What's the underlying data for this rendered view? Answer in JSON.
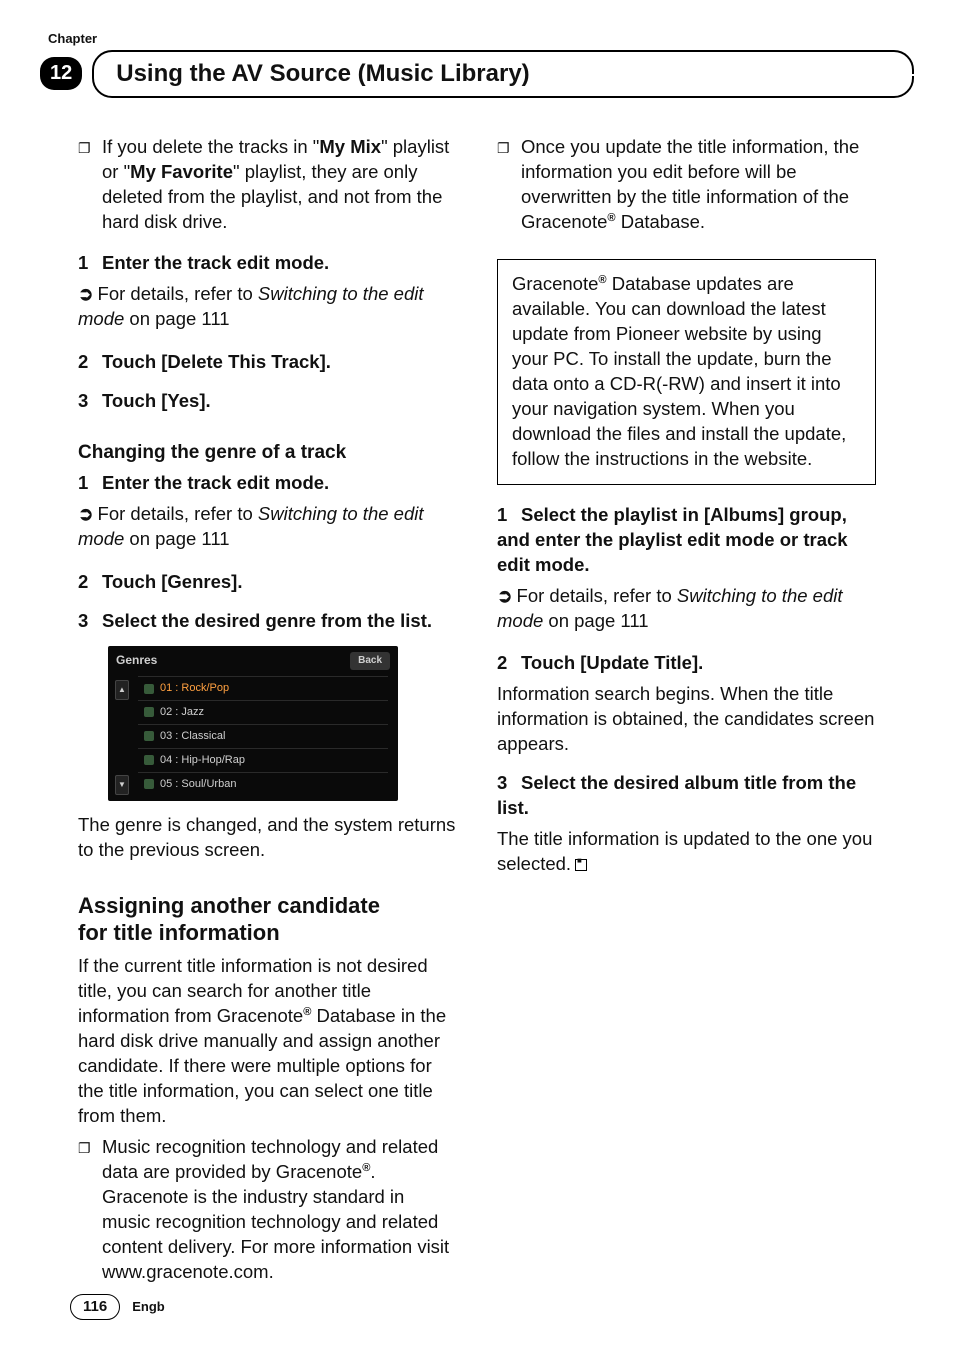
{
  "header": {
    "chapter_label": "Chapter",
    "chapter_number": "12",
    "section_title": "Using the AV Source (Music Library)"
  },
  "col1": {
    "intro_bullet_pre": "If you delete the tracks in \"",
    "intro_bullet_b1": "My Mix",
    "intro_bullet_mid": "\" playlist or \"",
    "intro_bullet_b2": "My Favorite",
    "intro_bullet_post": "\" playlist, they are only deleted from the playlist, and not from the hard disk drive.",
    "step1_num": "1",
    "step1_txt": "Enter the track edit mode.",
    "ref1_pre": "For details, refer to ",
    "ref1_ital": "Switching to the edit mode",
    "ref1_post": " on page 111",
    "step2_num": "2",
    "step2_txt": "Touch [Delete This Track].",
    "step3_num": "3",
    "step3_txt": "Touch [Yes].",
    "h3_genre": "Changing the genre of a track",
    "g_step1_num": "1",
    "g_step1_txt": "Enter the track edit mode.",
    "g_ref_pre": "For details, refer to ",
    "g_ref_ital": "Switching to the edit mode",
    "g_ref_post": " on page 111",
    "g_step2_num": "2",
    "g_step2_txt": "Touch [Genres].",
    "g_step3_num": "3",
    "g_step3_txt": "Select the desired genre from the list.",
    "shot": {
      "title": "Genres",
      "back": "Back",
      "rows": [
        "01 : Rock/Pop",
        "02 : Jazz",
        "03 : Classical",
        "04 : Hip-Hop/Rap",
        "05 : Soul/Urban"
      ]
    },
    "after_shot": "The genre is changed, and the system returns to the previous screen.",
    "h2_assign_l1": "Assigning another candidate",
    "h2_assign_l2": "for title information",
    "assign_para_1": "If the current title information is not desired title, you can search for another title information from Gracenote",
    "assign_para_2": " Database in the hard disk drive manually and assign another candidate. If there were multiple options for the title information, you can select one title from them.",
    "assign_bullet_1": "Music recognition technology and related data are provided by Gracenote",
    "assign_bullet_2": ". Gracenote is the industry standard in music recognition technology and related content delivery. For more information visit www.gracenote.com."
  },
  "col2": {
    "top_bullet_1": "Once you update the title information, the information you edit before will be overwritten by the title information of the Gracenote",
    "top_bullet_2": " Database.",
    "note_1": "Gracenote",
    "note_2": " Database updates are available. You can download the latest update from Pioneer website by using your PC. To install the update, burn the data onto a CD-R(-RW) and insert it into your navigation system. When you download the files and install the update, follow the instructions in the website.",
    "s1_num": "1",
    "s1_txt": "Select the playlist in [Albums] group, and enter the playlist edit mode or track edit mode.",
    "s1_ref_pre": "For details, refer to ",
    "s1_ref_ital": "Switching to the edit mode",
    "s1_ref_post": " on page 111",
    "s2_num": "2",
    "s2_txt": "Touch [Update Title].",
    "s2_body": "Information search begins. When the title information is obtained, the candidates screen appears.",
    "s3_num": "3",
    "s3_txt": "Select the desired album title from the list.",
    "s3_body": "The title information is updated to the one you selected."
  },
  "footer": {
    "page": "116",
    "lang": "Engb"
  },
  "tm": "®"
}
